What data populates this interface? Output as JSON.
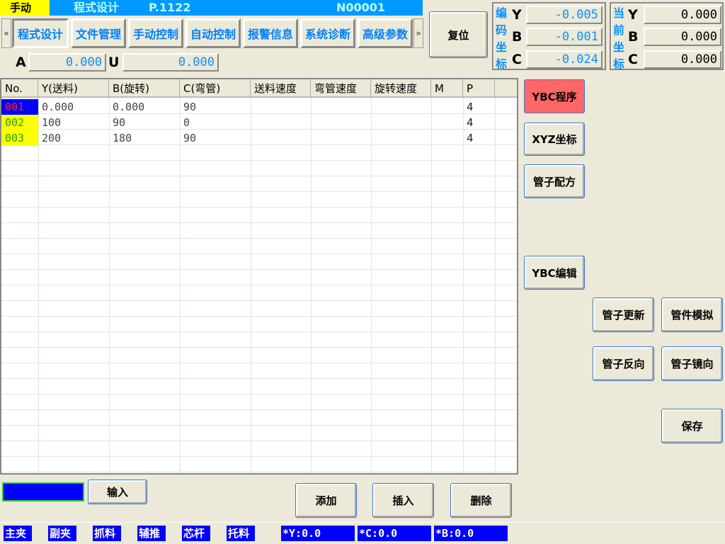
{
  "header": {
    "mode": "手动",
    "screen": "程式设计",
    "program": "P.1122",
    "line": "N00001"
  },
  "tabs": [
    {
      "label": "程式设计",
      "active": true
    },
    {
      "label": "文件管理"
    },
    {
      "label": "手动控制"
    },
    {
      "label": "自动控制"
    },
    {
      "label": "报警信息"
    },
    {
      "label": "系统诊断"
    },
    {
      "label": "高级参数"
    }
  ],
  "nav": {
    "prev": "«",
    "next": "»"
  },
  "aux_axes": [
    {
      "label": "A",
      "value": "0.000"
    },
    {
      "label": "U",
      "value": "0.000"
    }
  ],
  "reset_label": "复位",
  "encoder": {
    "title": "编码坐标",
    "axes": [
      {
        "label": "Y",
        "value": "-0.005"
      },
      {
        "label": "B",
        "value": "-0.001"
      },
      {
        "label": "C",
        "value": "-0.024"
      }
    ]
  },
  "current": {
    "title": "当前坐标",
    "axes": [
      {
        "label": "Y",
        "value": "0.000"
      },
      {
        "label": "B",
        "value": "0.000"
      },
      {
        "label": "C",
        "value": "0.000"
      }
    ]
  },
  "table": {
    "columns": [
      "No.",
      "Y(送料)",
      "B(旋转)",
      "C(弯管)",
      "送料速度",
      "弯管速度",
      "旋转速度",
      "M",
      "P",
      ""
    ],
    "rows": [
      [
        "001",
        "0.000",
        "0.000",
        "90",
        "",
        "",
        "",
        "",
        "4"
      ],
      [
        "002",
        "100",
        "90",
        "0",
        "",
        "",
        "",
        "",
        "4"
      ],
      [
        "003",
        "200",
        "180",
        "90",
        "",
        "",
        "",
        "",
        "4"
      ]
    ]
  },
  "side_buttons": {
    "ybc_program": "YBC程序",
    "xyz": "XYZ坐标",
    "recipe": "管子配方",
    "ybc_edit": "YBC编辑",
    "update": "管子更新",
    "simulate": "管件模拟",
    "reverse": "管子反向",
    "mirror": "管子镜向",
    "save": "保存"
  },
  "bottom": {
    "input_value": "",
    "input_button": "输入",
    "add": "添加",
    "insert": "插入",
    "delete": "删除"
  },
  "status": {
    "flags": [
      "主夹",
      "副夹",
      "抓料",
      "辅推",
      "芯杆",
      "托料"
    ],
    "readouts": [
      "*Y:0.0",
      "*C:0.0",
      "*B:0.0"
    ]
  },
  "colors": {
    "active_button": "#ff6666",
    "title_bar": "#0099ff",
    "mode_bg": "#ffff00",
    "status_bg": "#0000ff"
  }
}
